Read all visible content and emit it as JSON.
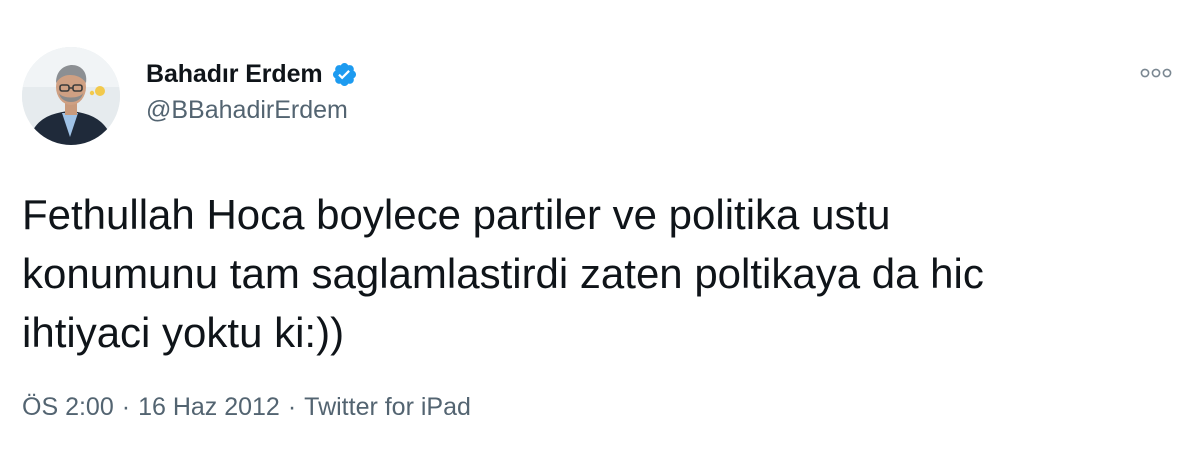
{
  "author": {
    "display_name": "Bahadır Erdem",
    "handle": "@BBahadirErdem",
    "verified": true,
    "verified_color": "#1d9bf0",
    "avatar_icon": "profile-photo"
  },
  "menu": {
    "icon": "more-options-icon"
  },
  "tweet": {
    "text": "Fethullah Hoca boylece partiler ve politika ustu\nkonumunu tam saglamlastirdi zaten poltikaya da hic\nihtiyaci yoktu ki:))"
  },
  "meta": {
    "time": "ÖS 2:00",
    "date": "16 Haz 2012",
    "source": "Twitter for iPad",
    "separator": "·"
  },
  "colors": {
    "text": "#0f1419",
    "secondary": "#536471"
  }
}
